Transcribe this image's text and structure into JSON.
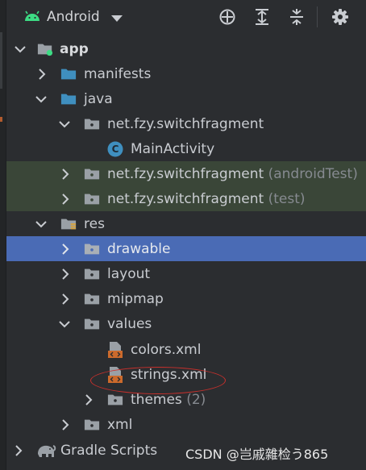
{
  "toolbar": {
    "view_label": "Android",
    "icons": [
      "android-icon",
      "dropdown-caret-icon",
      "locate-icon",
      "expand-all-icon",
      "collapse-all-icon",
      "settings-icon"
    ]
  },
  "colors": {
    "accent_selected": "#4a6bb5",
    "test_source_bg": "#3a4638",
    "folder_blue": "#3f8fbf",
    "android_green": "#3ddc84",
    "xml_orange": "#cc6a2c",
    "annotation_red": "#c9302c"
  },
  "tree": {
    "app": "app",
    "manifests": "manifests",
    "java": "java",
    "pkg_main": "net.fzy.switchfragment",
    "main_activity": "MainActivity",
    "main_activity_badge": "C",
    "pkg_android_test": "net.fzy.switchfragment",
    "pkg_android_test_suffix": "(androidTest)",
    "pkg_test": "net.fzy.switchfragment",
    "pkg_test_suffix": "(test)",
    "res": "res",
    "drawable": "drawable",
    "layout": "layout",
    "mipmap": "mipmap",
    "values": "values",
    "colors_xml": "colors.xml",
    "strings_xml": "strings.xml",
    "themes": "themes",
    "themes_count": "(2)",
    "xml": "xml",
    "gradle_scripts": "Gradle Scripts"
  },
  "watermark": "CSDN @岂戚雜检う865"
}
